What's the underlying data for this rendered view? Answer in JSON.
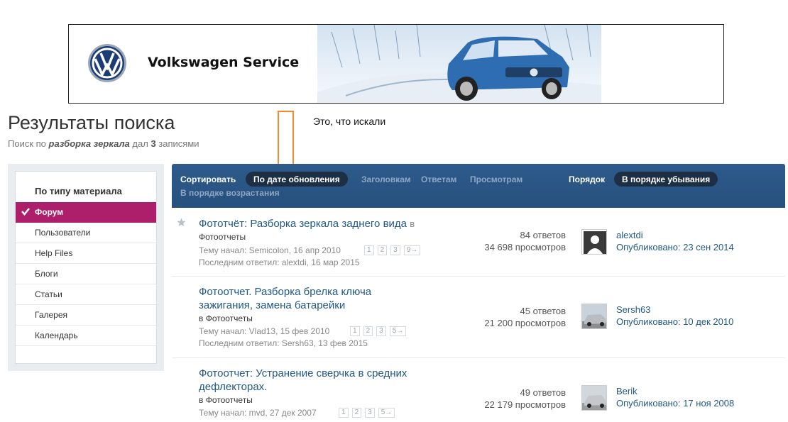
{
  "banner": {
    "title": "Volkswagen Service"
  },
  "page": {
    "title": "Результаты поиска",
    "subtitle_prefix": "Поиск по",
    "query": "разборка зеркала",
    "subtitle_mid": "дал",
    "count": "3",
    "subtitle_suffix": "записями"
  },
  "annotation": {
    "text": "Это, что искали"
  },
  "sidebar": {
    "heading": "По типу материала",
    "items": [
      {
        "label": "Форум",
        "active": true
      },
      {
        "label": "Пользователи"
      },
      {
        "label": "Help Files"
      },
      {
        "label": "Блоги"
      },
      {
        "label": "Статьи"
      },
      {
        "label": "Галерея"
      },
      {
        "label": "Календарь"
      }
    ]
  },
  "sortbar": {
    "sort_label": "Сортировать",
    "sort_active": "По дате обновления",
    "sort_options": [
      "Заголовкам",
      "Ответам",
      "Просмотрам"
    ],
    "order_label": "Порядок",
    "order_active": "В порядке убывания",
    "order_other": "В порядке возрастания"
  },
  "topics": [
    {
      "title": "Фототчёт: Разборка зеркала заднего вида",
      "in": "в",
      "forum": "Фотоотчеты",
      "started": "Тему начал: Semicolon, 16 апр 2010",
      "pages": [
        "1",
        "2",
        "3",
        "9→"
      ],
      "last": "Последним ответил: alextdi, 16 мар 2015",
      "replies": "84 ответов",
      "views": "34 698 просмотров",
      "author": "alextdi",
      "posted": "Опубликовано: 23 сен 2014"
    },
    {
      "title_line1": "Фотоотчет. Разборка брелка ключа",
      "title_line2": "зажигания, замена батарейки",
      "forum": "в Фотоотчеты",
      "started": "Тему начал: Vlad13, 15 фев 2010",
      "pages": [
        "1",
        "2",
        "3",
        "5→"
      ],
      "last": "Последним ответил: Sersh63, 13 фев 2015",
      "replies": "45 ответов",
      "views": "21 200 просмотров",
      "author": "Sersh63",
      "posted": "Опубликовано: 10 дек 2010"
    },
    {
      "title_line1": "Фотоотчет: Устранение сверчка в средних",
      "title_line2": "дефлекторах.",
      "forum": "в Фотоотчеты",
      "started": "Тему начал: mvd, 27 дек 2007",
      "pages": [
        "1",
        "2",
        "3",
        "5→"
      ],
      "replies": "49 ответов",
      "views": "22 179 просмотров",
      "author": "Berik",
      "posted": "Опубликовано: 17 ноя 2008"
    }
  ]
}
